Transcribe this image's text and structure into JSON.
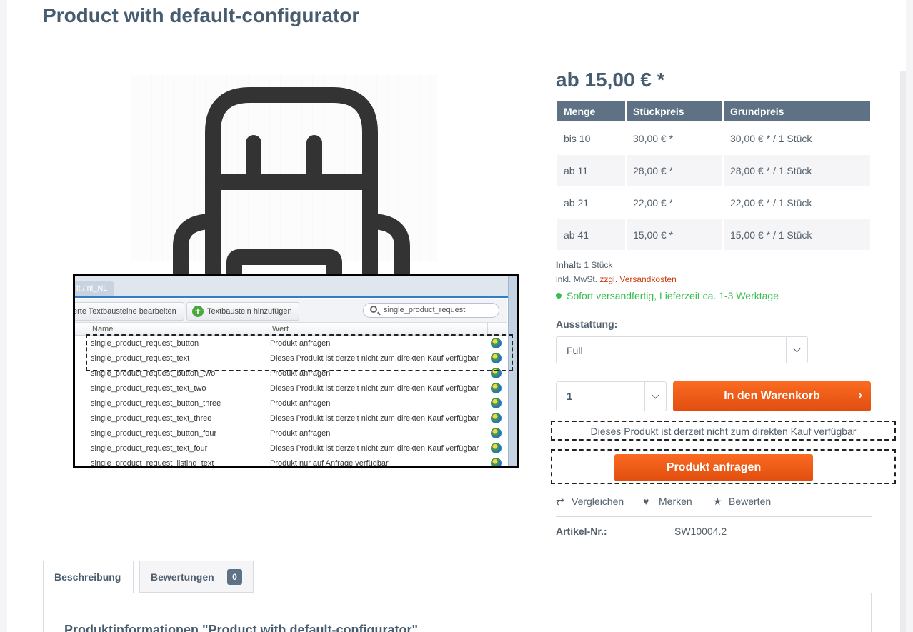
{
  "page": {
    "title": "Product with default-configurator"
  },
  "inset": {
    "tab_label": "lt / nl_NL",
    "edit_button": "erte Textbausteine bearbeiten",
    "add_button": "Textbaustein hinzufügen",
    "search_value": "single_product_request",
    "col_name": "Name",
    "col_value": "Wert",
    "rows": [
      {
        "name": "single_product_request_button",
        "value": "Produkt anfragen"
      },
      {
        "name": "single_product_request_text",
        "value": "Dieses Produkt ist derzeit nicht zum direkten Kauf verfügbar"
      },
      {
        "name": "single_product_request_button_two",
        "value": "Produkt anfragen"
      },
      {
        "name": "single_product_request_text_two",
        "value": "Dieses Produkt ist derzeit nicht zum direkten Kauf verfügbar"
      },
      {
        "name": "single_product_request_button_three",
        "value": "Produkt anfragen"
      },
      {
        "name": "single_product_request_text_three",
        "value": "Dieses Produkt ist derzeit nicht zum direkten Kauf verfügbar"
      },
      {
        "name": "single_product_request_button_four",
        "value": "Produkt anfragen"
      },
      {
        "name": "single_product_request_text_four",
        "value": "Dieses Produkt ist derzeit nicht zum direkten Kauf verfügbar"
      },
      {
        "name": "single_product_request_listing_text",
        "value": "Produkt nur auf Anfrage verfügbar"
      }
    ]
  },
  "product": {
    "price": "ab 15,00 € *",
    "price_table": {
      "headers": [
        "Menge",
        "Stückpreis",
        "Grundpreis"
      ],
      "rows": [
        [
          "bis 10",
          "30,00 € *",
          "30,00 € * / 1 Stück"
        ],
        [
          "ab 11",
          "28,00 € *",
          "28,00 € * / 1 Stück"
        ],
        [
          "ab 21",
          "22,00 € *",
          "22,00 € * / 1 Stück"
        ],
        [
          "ab 41",
          "15,00 € *",
          "15,00 € * / 1 Stück"
        ]
      ]
    },
    "content_label": "Inhalt:",
    "content_value": "1 Stück",
    "tax_text": "inkl. MwSt.",
    "shipping_link": "zzgl. Versandkosten",
    "delivery": "Sofort versandfertig, Lieferzeit ca. 1-3 Werktage",
    "option_label": "Ausstattung:",
    "option_value": "Full",
    "quantity": "1",
    "cart_button": "In den Warenkorb",
    "cart_arrow": "›",
    "request_notice": "Dieses Produkt ist derzeit nicht zum direkten Kauf verfügbar",
    "request_button": "Produkt anfragen",
    "actions": {
      "compare": "Vergleichen",
      "remember": "Merken",
      "rate": "Bewerten"
    },
    "article_label": "Artikel-Nr.:",
    "article_value": "SW10004.2"
  },
  "tabs": {
    "description": "Beschreibung",
    "reviews": "Bewertungen",
    "reviews_count": "0"
  },
  "description_heading": "Produktinformationen \"Product with default-configurator\"",
  "icons": {
    "compare": "compare-arrows-icon",
    "remember": "heart-icon",
    "rate": "star-icon",
    "add": "plus-icon",
    "search": "search-icon",
    "globe": "globe-icon"
  },
  "colors": {
    "accent": "#e95613",
    "table_header": "#5f7285",
    "delivery_green": "#35be4e",
    "shipping_link": "#d03d13"
  }
}
